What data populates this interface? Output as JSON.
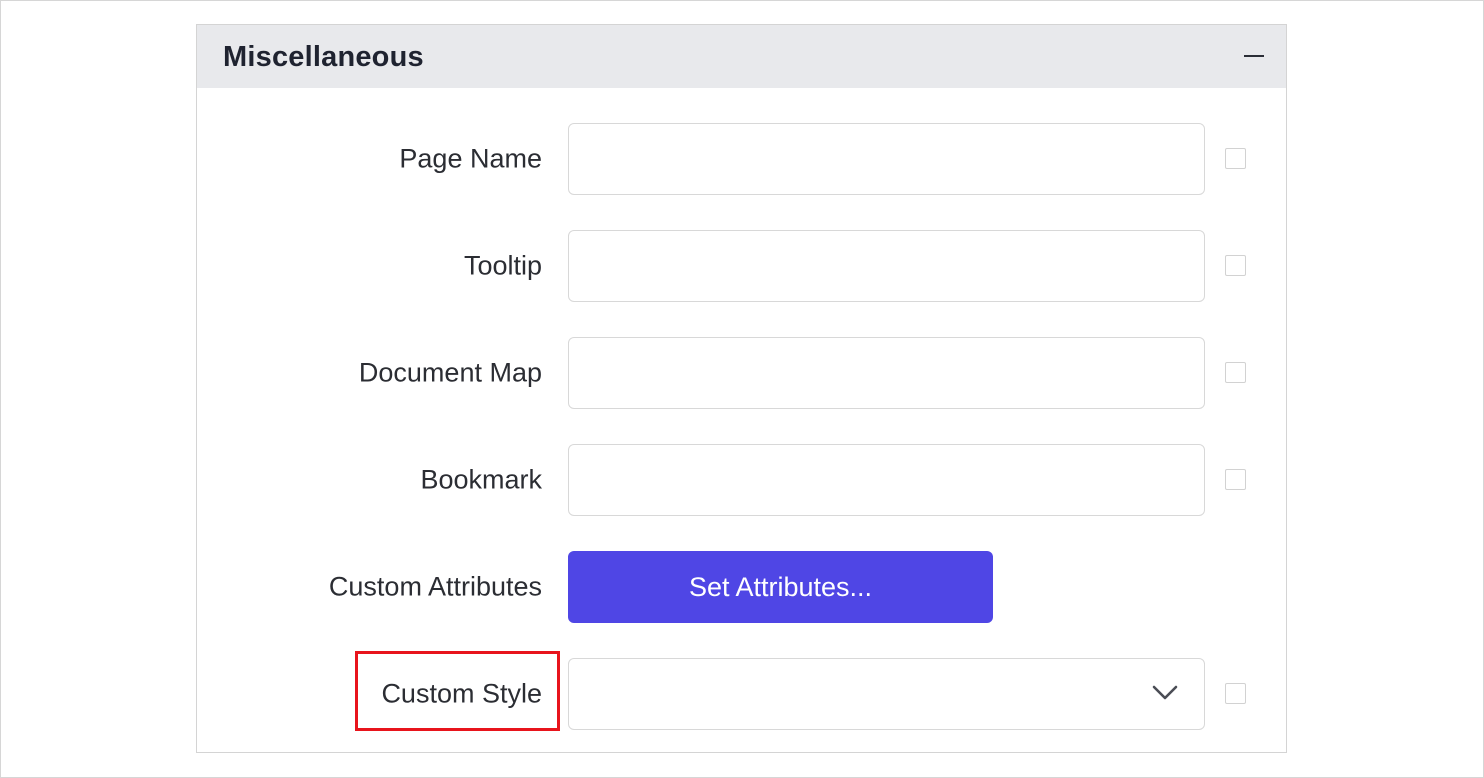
{
  "panel": {
    "title": "Miscellaneous",
    "collapse_icon": "minus-icon"
  },
  "fields": [
    {
      "label": "Page Name",
      "value": "",
      "placeholder": ""
    },
    {
      "label": "Tooltip",
      "value": "",
      "placeholder": ""
    },
    {
      "label": "Document Map",
      "value": "",
      "placeholder": ""
    },
    {
      "label": "Bookmark",
      "value": "",
      "placeholder": ""
    }
  ],
  "custom_attributes": {
    "label": "Custom Attributes",
    "button_label": "Set Attributes..."
  },
  "custom_style": {
    "label": "Custom Style",
    "selected_value": "",
    "dropdown_icon": "chevron-down-icon"
  },
  "colors": {
    "accent": "#4f46e5",
    "header_bg": "#e8e9ec",
    "highlight": "#e8141c"
  }
}
